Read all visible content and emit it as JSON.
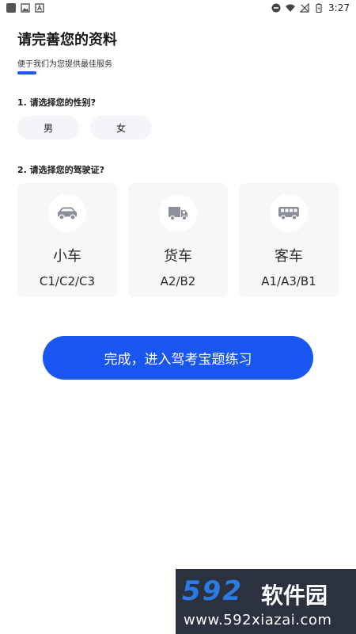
{
  "status_bar": {
    "time": "3:27"
  },
  "header": {
    "title": "请完善您的资料",
    "subtitle": "便于我们为您提供最佳服务"
  },
  "question_gender": {
    "label": "1. 请选择您的性别?",
    "options": [
      "男",
      "女"
    ]
  },
  "question_license": {
    "label": "2. 请选择您的驾驶证?",
    "options": [
      {
        "name": "小车",
        "codes": "C1/C2/C3",
        "icon": "car-icon"
      },
      {
        "name": "货车",
        "codes": "A2/B2",
        "icon": "truck-icon"
      },
      {
        "name": "客车",
        "codes": "A1/A3/B1",
        "icon": "bus-icon"
      }
    ]
  },
  "finish_button": {
    "label": "完成，进入驾考宝题练习"
  },
  "watermark": {
    "brand_number": "592",
    "brand_text": "软件园",
    "url": "www.592xiazai.com"
  },
  "colors": {
    "accent": "#1a56f0",
    "card_bg": "#f6f7f9",
    "pill_bg": "#f4f5f8",
    "icon_gray": "#8a8f99"
  }
}
